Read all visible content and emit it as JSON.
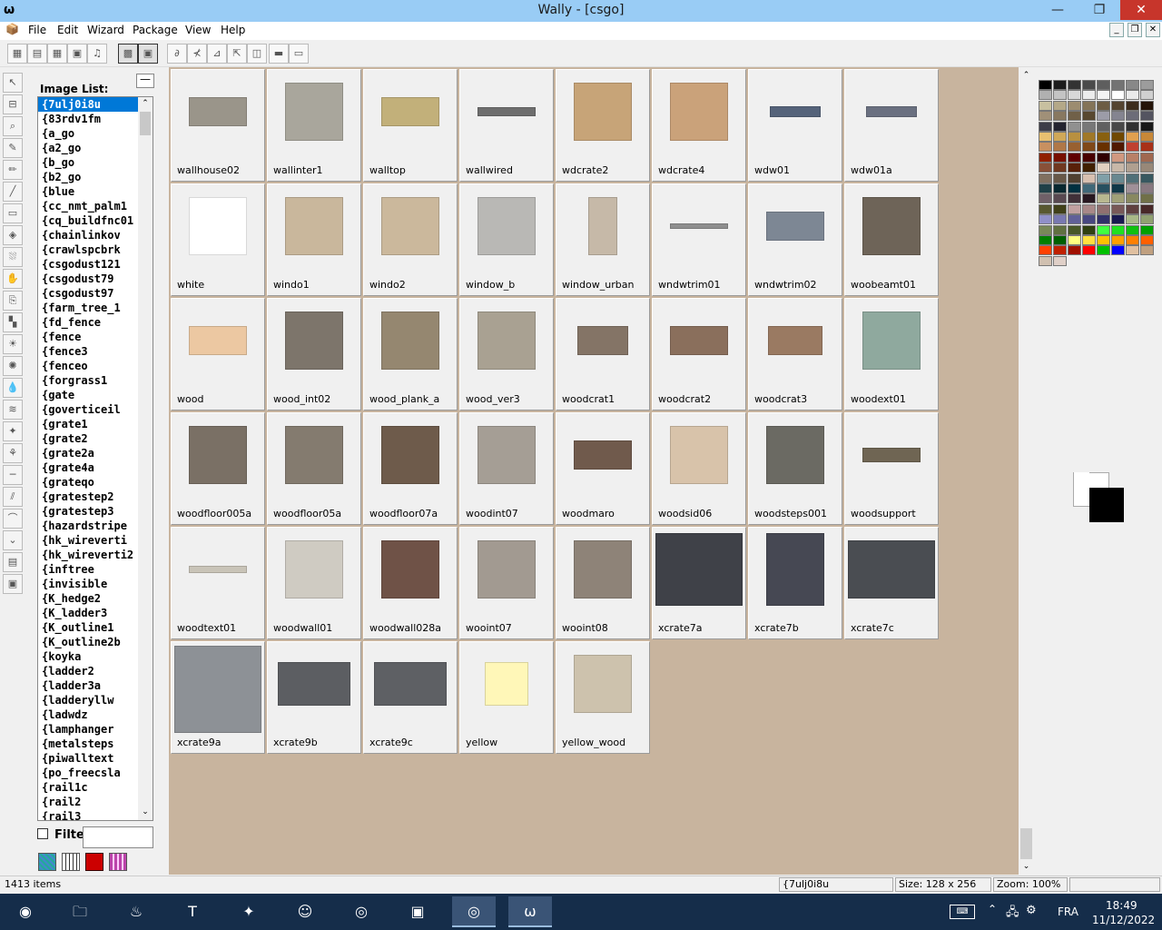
{
  "window": {
    "title": "Wally - [csgo]",
    "app_icon": "wally-icon"
  },
  "menu": [
    "File",
    "Edit",
    "Wizard",
    "Package",
    "View",
    "Help"
  ],
  "toolbar": {
    "icons": [
      "image-properties-icon",
      "grid-icon",
      "grid-2-icon",
      "image-view-icon",
      "music-icon",
      "grid-fill-icon",
      "tile-icon",
      "rotate-icon",
      "arrow-icon",
      "triangle-icon",
      "arrow-up-icon",
      "box-icon",
      "box-2-icon",
      "box-3-icon"
    ]
  },
  "left_tools": [
    "select-icon",
    "ruler-icon",
    "zoom-icon",
    "eyedropper-icon",
    "pencil-icon",
    "brush-icon",
    "eraser-icon",
    "fill-icon",
    "spray-icon",
    "hand-icon",
    "clone-icon",
    "rect-select-icon",
    "sun-icon",
    "sun-2-icon",
    "drop-icon",
    "blur-icon",
    "sparkle-icon",
    "figure-icon",
    "line-icon",
    "hatch-icon",
    "wrench-icon",
    "scroll-down-icon",
    "pattern-icon",
    "stamp-icon"
  ],
  "image_list": {
    "label": "Image List:",
    "items": [
      "{7ulj0i8u",
      "{83rdv1fm",
      "{a_go",
      "{a2_go",
      "{b_go",
      "{b2_go",
      "{blue",
      "{cc_nmt_palm1",
      "{cq_buildfnc01",
      "{chainlinkov",
      "{crawlspcbrk",
      "{csgodust121",
      "{csgodust79",
      "{csgodust97",
      "{farm_tree_1",
      "{fd_fence",
      "{fence",
      "{fence3",
      "{fenceo",
      "{forgrass1",
      "{gate",
      "{goverticeil",
      "{grate1",
      "{grate2",
      "{grate2a",
      "{grate4a",
      "{grateqo",
      "{gratestep2",
      "{gratestep3",
      "{hazardstripe",
      "{hk_wireverti",
      "{hk_wireverti2",
      "{inftree",
      "{invisible",
      "{K_hedge2",
      "{K_ladder3",
      "{K_outline1",
      "{K_outline2b",
      "{koyka",
      "{ladder2",
      "{ladder3a",
      "{ladderyllw",
      "{ladwdz",
      "{lamphanger",
      "{metalsteps",
      "{piwalltext",
      "{po_freecsla",
      "{rail1c",
      "{rail2",
      "{rail3"
    ],
    "selected_index": 0,
    "filter_label": "Filte",
    "filter_value": ""
  },
  "textures": [
    {
      "name": "wallhouse02",
      "color": "#9a958a",
      "w": 64,
      "h": 32
    },
    {
      "name": "wallinter1",
      "color": "#a9a69c",
      "w": 64,
      "h": 64
    },
    {
      "name": "walltop",
      "color": "#c2b07a",
      "w": 64,
      "h": 32
    },
    {
      "name": "wallwired",
      "color": "#6e6e6e",
      "w": 64,
      "h": 10
    },
    {
      "name": "wdcrate2",
      "color": "#c7a478",
      "w": 64,
      "h": 64
    },
    {
      "name": "wdcrate4",
      "color": "#caa27a",
      "w": 64,
      "h": 64
    },
    {
      "name": "wdw01",
      "color": "#55637a",
      "w": 56,
      "h": 12
    },
    {
      "name": "wdw01a",
      "color": "#6a7080",
      "w": 56,
      "h": 12
    },
    {
      "name": "white",
      "color": "#ffffff",
      "w": 64,
      "h": 64
    },
    {
      "name": "windo1",
      "color": "#c9b79c",
      "w": 64,
      "h": 64
    },
    {
      "name": "windo2",
      "color": "#cbb89c",
      "w": 64,
      "h": 64
    },
    {
      "name": "window_b",
      "color": "#b9b8b5",
      "w": 64,
      "h": 64
    },
    {
      "name": "window_urban",
      "color": "#c6b9a8",
      "w": 32,
      "h": 64
    },
    {
      "name": "wndwtrim01",
      "color": "#8f8f8f",
      "w": 64,
      "h": 6
    },
    {
      "name": "wndwtrim02",
      "color": "#7d8794",
      "w": 64,
      "h": 32
    },
    {
      "name": "woobeamt01",
      "color": "#6e6458",
      "w": 64,
      "h": 64
    },
    {
      "name": "wood",
      "color": "#ecc8a2",
      "w": 64,
      "h": 32
    },
    {
      "name": "wood_int02",
      "color": "#7d756b",
      "w": 64,
      "h": 64
    },
    {
      "name": "wood_plank_a",
      "color": "#958770",
      "w": 64,
      "h": 64
    },
    {
      "name": "wood_ver3",
      "color": "#a9a192",
      "w": 64,
      "h": 64
    },
    {
      "name": "woodcrat1",
      "color": "#847466",
      "w": 56,
      "h": 32
    },
    {
      "name": "woodcrat2",
      "color": "#8a6f5c",
      "w": 64,
      "h": 32
    },
    {
      "name": "woodcrat3",
      "color": "#9a7a62",
      "w": 60,
      "h": 32
    },
    {
      "name": "woodext01",
      "color": "#8fa99e",
      "w": 64,
      "h": 64
    },
    {
      "name": "woodfloor005a",
      "color": "#7a7065",
      "w": 64,
      "h": 64
    },
    {
      "name": "woodfloor05a",
      "color": "#847b6f",
      "w": 64,
      "h": 64
    },
    {
      "name": "woodfloor07a",
      "color": "#6e5b4b",
      "w": 64,
      "h": 64
    },
    {
      "name": "woodint07",
      "color": "#a59e95",
      "w": 64,
      "h": 64
    },
    {
      "name": "woodmaro",
      "color": "#705a4c",
      "w": 64,
      "h": 32
    },
    {
      "name": "woodsid06",
      "color": "#d8c3aa",
      "w": 64,
      "h": 64
    },
    {
      "name": "woodsteps001",
      "color": "#6b6a63",
      "w": 64,
      "h": 64
    },
    {
      "name": "woodsupport",
      "color": "#6f6553",
      "w": 64,
      "h": 16
    },
    {
      "name": "woodtext01",
      "color": "#c9c4b8",
      "w": 64,
      "h": 8
    },
    {
      "name": "woodwall01",
      "color": "#cfcbc2",
      "w": 64,
      "h": 64
    },
    {
      "name": "woodwall028a",
      "color": "#6f5247",
      "w": 64,
      "h": 64
    },
    {
      "name": "wooint07",
      "color": "#a29a91",
      "w": 64,
      "h": 64
    },
    {
      "name": "wooint08",
      "color": "#8e8378",
      "w": 64,
      "h": 64
    },
    {
      "name": "xcrate7a",
      "color": "#3f4148",
      "w": 96,
      "h": 80
    },
    {
      "name": "xcrate7b",
      "color": "#464853",
      "w": 64,
      "h": 80
    },
    {
      "name": "xcrate7c",
      "color": "#4a4d52",
      "w": 96,
      "h": 64
    },
    {
      "name": "xcrate9a",
      "color": "#8d9196",
      "w": 96,
      "h": 96
    },
    {
      "name": "xcrate9b",
      "color": "#5c5e62",
      "w": 80,
      "h": 48
    },
    {
      "name": "xcrate9c",
      "color": "#5e6064",
      "w": 80,
      "h": 48
    },
    {
      "name": "yellow",
      "color": "#fff7b8",
      "w": 48,
      "h": 48
    },
    {
      "name": "yellow_wood",
      "color": "#cdc2ad",
      "w": 64,
      "h": 64
    }
  ],
  "palette": [
    "#000000",
    "#1c1c1c",
    "#333333",
    "#4a4a4a",
    "#5e5e5e",
    "#737373",
    "#888888",
    "#9c9c9c",
    "#b0b0b0",
    "#c4c4c4",
    "#d8d8d8",
    "#ececec",
    "#f4f4f4",
    "#ffffff",
    "#eaeaea",
    "#d0d0d0",
    "#c8c0a0",
    "#b4a888",
    "#9c8c70",
    "#847458",
    "#6c5c44",
    "#544430",
    "#3c2c1c",
    "#241408",
    "#a09078",
    "#887860",
    "#706048",
    "#584830",
    "#9c9ca8",
    "#848490",
    "#6c6c78",
    "#545460",
    "#3c3c48",
    "#242430",
    "#909090",
    "#787878",
    "#606060",
    "#484848",
    "#303030",
    "#181818",
    "#e8c070",
    "#d0a858",
    "#b89040",
    "#a07828",
    "#886010",
    "#704800",
    "#e0a050",
    "#c88838",
    "#c89060",
    "#b07848",
    "#986030",
    "#804818",
    "#683000",
    "#501800",
    "#c04030",
    "#a83018",
    "#902000",
    "#781000",
    "#600000",
    "#480000",
    "#300000",
    "#d09880",
    "#b88068",
    "#a06850",
    "#885038",
    "#703820",
    "#582008",
    "#402000",
    "#e0d0c0",
    "#c8b8a8",
    "#b0a090",
    "#988878",
    "#807060",
    "#685848",
    "#504030",
    "#d8c0b0",
    "#80a0a8",
    "#688890",
    "#507078",
    "#385860",
    "#204048",
    "#082830",
    "#003040",
    "#406878",
    "#285060",
    "#103848",
    "#a09098",
    "#887880",
    "#706068",
    "#584850",
    "#403038",
    "#281820",
    "#b8b890",
    "#a0a078",
    "#888860",
    "#707048",
    "#585830",
    "#404018",
    "#c0a0a0",
    "#a88888",
    "#907070",
    "#785858",
    "#604040",
    "#482828",
    "#9090c8",
    "#7878b0",
    "#606098",
    "#484880",
    "#303068",
    "#181850",
    "#a8b888",
    "#90a070",
    "#788858",
    "#607040",
    "#485828",
    "#304010",
    "#40ff40",
    "#20e020",
    "#10c010",
    "#00a000",
    "#008000",
    "#006000",
    "#ffff80",
    "#ffe040",
    "#ffc000",
    "#ffa000",
    "#ff8000",
    "#ff6000",
    "#ff4000",
    "#c02000",
    "#a01000",
    "#ff0000",
    "#00c000",
    "#0000ff",
    "#e0c0a0",
    "#c0a080",
    "#d0c0b0",
    "#e0d0c8"
  ],
  "status": {
    "count": "1413 items",
    "selected": "{7ulj0i8u",
    "size": "Size: 128 x 256",
    "zoom": "Zoom: 100%"
  },
  "taskbar": {
    "apps": [
      "start-icon",
      "file-explorer-icon",
      "steam-icon",
      "hammer-icon",
      "tool-icon",
      "discord-icon",
      "chrome-icon",
      "app-icon",
      "chrome-2-icon",
      "wally-icon"
    ],
    "lang": "FRA",
    "time": "18:49",
    "date": "11/12/2022",
    "tray": [
      "keyboard-icon",
      "chevron-up-icon",
      "network-icon",
      "steam-tray-icon"
    ]
  }
}
